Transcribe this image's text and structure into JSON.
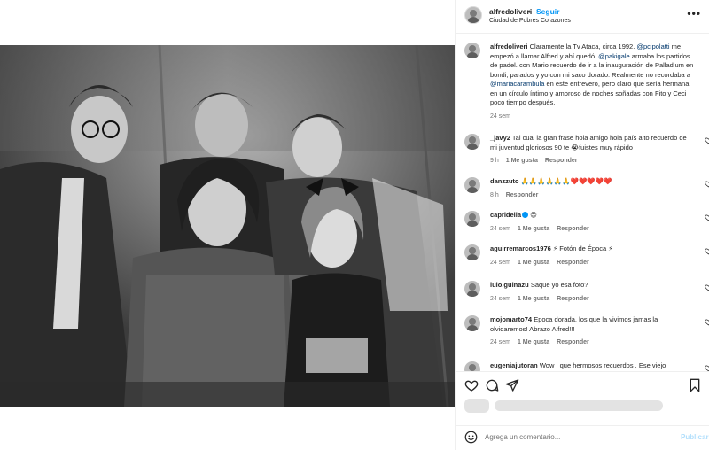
{
  "post": {
    "username": "alfredoliveri",
    "dot": "•",
    "follow": "Seguir",
    "location": "Ciudad de Pobres Corazones",
    "more": "•••"
  },
  "caption": {
    "username": "alfredoliveri",
    "t1": " Claramente la Tv Ataca, circa 1992. ",
    "m1": "@pcipolatti",
    "t2": " me empezó a llamar Alfred y ahí quedó. ",
    "m2": "@pakigale",
    "t3": " armaba los partidos de padel. con Mario recuerdo de ir a la inauguración de Palladium en bondi, parados y yo con mi saco dorado. Realmente no recordaba a ",
    "m3": "@mariacarambula",
    "t4": " en este entrevero, pero claro que sería hermana en un círculo íntimo y amoroso de noches soñadas con Fito y Ceci poco tiempo después.",
    "time": "24 sem"
  },
  "comments": [
    {
      "username": "_javy2",
      "text": " Tal cual la gran frase hola amigo hola país alto recuerdo de mi juventud gloriosos 90 te 😭fuistes muy rápido",
      "time": "9 h",
      "likes": "1 Me gusta",
      "reply": "Responder"
    },
    {
      "username": "danzzuto",
      "text": " 🙏🙏🙏🙏🙏🙏❤️❤️❤️❤️❤️",
      "time": "8 h",
      "likes": "",
      "reply": "Responder"
    },
    {
      "username": "caprideila",
      "text": " 😍",
      "time": "24 sem",
      "likes": "1 Me gusta",
      "reply": "Responder",
      "verified": true
    },
    {
      "username": "aguirremarcos1976",
      "text": " ⚡ Fotón de Época ⚡",
      "time": "24 sem",
      "likes": "1 Me gusta",
      "reply": "Responder"
    },
    {
      "username": "lulo.guinazu",
      "text": " Saque yo esa foto?",
      "time": "24 sem",
      "likes": "1 Me gusta",
      "reply": "Responder"
    },
    {
      "username": "mojomarto74",
      "text": " Epoca dorada, los que la vivimos jamas la olvidaremos! Abrazo Alfred!!!",
      "time": "24 sem",
      "likes": "1 Me gusta",
      "reply": "Responder"
    },
    {
      "username": "eugeniajutoran",
      "text": " Wow , que hermosos recuerdos . Ese viejo",
      "time": "",
      "likes": "",
      "reply": ""
    }
  ],
  "add_comment": {
    "placeholder": "Agrega un comentario...",
    "publish": "Publicar"
  },
  "icons": [
    "heart-icon",
    "comment-icon",
    "share-icon",
    "bookmark-icon",
    "emoji-icon",
    "more-icon"
  ]
}
